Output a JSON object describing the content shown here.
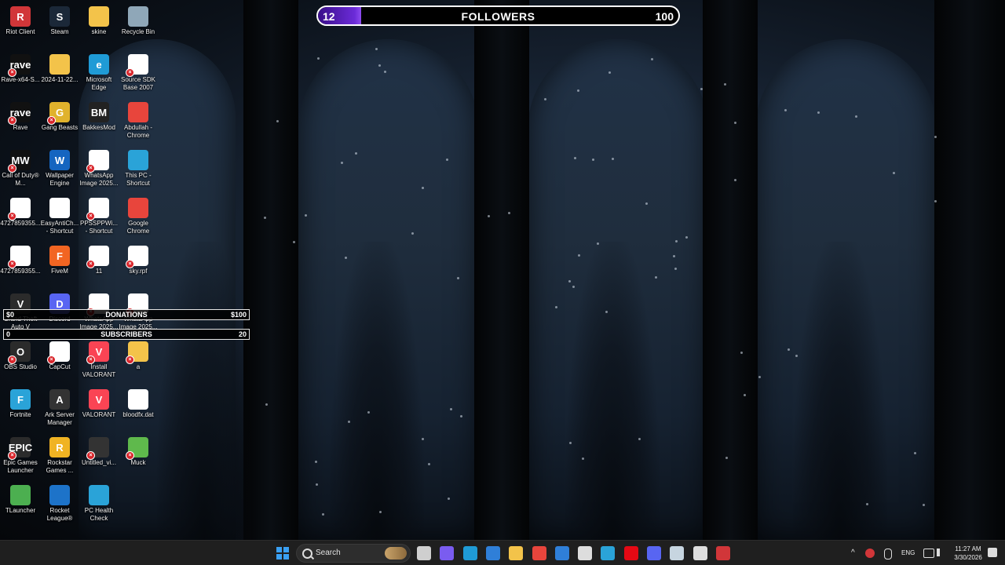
{
  "desktop": {
    "icons": [
      {
        "label": "Riot Client",
        "icon": "riot-client-icon",
        "color": "#d13639",
        "glyph": "R",
        "broken": false
      },
      {
        "label": "Steam",
        "icon": "steam-icon",
        "color": "#1b2838",
        "glyph": "S",
        "broken": false
      },
      {
        "label": "skine",
        "icon": "folder-icon",
        "color": "#f3c34a",
        "glyph": "",
        "broken": false
      },
      {
        "label": "Recycle Bin",
        "icon": "recycle-bin-icon",
        "color": "#8fa7b8",
        "glyph": "",
        "broken": false
      },
      {
        "label": "Rave-x64-S...",
        "icon": "rave-icon",
        "color": "#111111",
        "glyph": "rave",
        "broken": true
      },
      {
        "label": "2024-11-22...",
        "icon": "folder-icon",
        "color": "#f3c34a",
        "glyph": "",
        "broken": false
      },
      {
        "label": "Microsoft Edge",
        "icon": "edge-icon",
        "color": "#1f9bd6",
        "glyph": "e",
        "broken": false
      },
      {
        "label": "Source SDK Base 2007",
        "icon": "file-icon",
        "color": "#ffffff",
        "glyph": "",
        "broken": true
      },
      {
        "label": "Rave",
        "icon": "rave-icon",
        "color": "#111111",
        "glyph": "rave",
        "broken": true
      },
      {
        "label": "Gang Beasts",
        "icon": "gang-beasts-icon",
        "color": "#e0b22c",
        "glyph": "G",
        "broken": true
      },
      {
        "label": "BakkesMod",
        "icon": "bakkesmod-icon",
        "color": "#222222",
        "glyph": "BM",
        "broken": false
      },
      {
        "label": "Abdullah - Chrome",
        "icon": "chrome-icon",
        "color": "#e8453c",
        "glyph": "",
        "broken": false
      },
      {
        "label": "Call of Duty® M...",
        "icon": "call-of-duty-icon",
        "color": "#111111",
        "glyph": "MW",
        "broken": true
      },
      {
        "label": "Wallpaper Engine",
        "icon": "wallpaper-engine-icon",
        "color": "#1565c0",
        "glyph": "W",
        "broken": false
      },
      {
        "label": "WhatsApp Image 2025...",
        "icon": "image-file-icon",
        "color": "#ffffff",
        "glyph": "",
        "broken": true
      },
      {
        "label": "This PC - Shortcut",
        "icon": "this-pc-icon",
        "color": "#2aa3d8",
        "glyph": "",
        "broken": false
      },
      {
        "label": "4727859355...",
        "icon": "video-file-icon",
        "color": "#ffffff",
        "glyph": "",
        "broken": true
      },
      {
        "label": "EasyAntiCh... - Shortcut",
        "icon": "easyanticheat-icon",
        "color": "#ffffff",
        "glyph": "",
        "broken": false
      },
      {
        "label": "PPSSPPWi... - Shortcut",
        "icon": "ppsspp-icon",
        "color": "#ffffff",
        "glyph": "",
        "broken": true
      },
      {
        "label": "Google Chrome",
        "icon": "chrome-icon",
        "color": "#e8453c",
        "glyph": "",
        "broken": false
      },
      {
        "label": "4727859355...",
        "icon": "video-file-icon",
        "color": "#ffffff",
        "glyph": "",
        "broken": true
      },
      {
        "label": "FiveM",
        "icon": "fivem-icon",
        "color": "#f26522",
        "glyph": "F",
        "broken": false
      },
      {
        "label": "11",
        "icon": "image-file-icon",
        "color": "#ffffff",
        "glyph": "",
        "broken": true
      },
      {
        "label": "sky.rpf",
        "icon": "file-icon",
        "color": "#ffffff",
        "glyph": "",
        "broken": true
      },
      {
        "label": "Grand Theft Auto V",
        "icon": "gta-v-icon",
        "color": "#2b2b2b",
        "glyph": "V",
        "broken": false
      },
      {
        "label": "Discord",
        "icon": "discord-icon",
        "color": "#5865f2",
        "glyph": "D",
        "broken": false
      },
      {
        "label": "WhatsApp Image 2025...",
        "icon": "image-file-icon",
        "color": "#ffffff",
        "glyph": "",
        "broken": true
      },
      {
        "label": "WhatsApp Image 2025...",
        "icon": "image-file-icon",
        "color": "#ffffff",
        "glyph": "",
        "broken": true
      },
      {
        "label": "OBS Studio",
        "icon": "obs-studio-icon",
        "color": "#2b2b2b",
        "glyph": "O",
        "broken": true
      },
      {
        "label": "CapCut",
        "icon": "capcut-icon",
        "color": "#ffffff",
        "glyph": "",
        "broken": true
      },
      {
        "label": "Install VALORANT",
        "icon": "valorant-icon",
        "color": "#fa4454",
        "glyph": "V",
        "broken": true
      },
      {
        "label": "a",
        "icon": "folder-icon",
        "color": "#f3c34a",
        "glyph": "",
        "broken": true
      },
      {
        "label": "Fortnite",
        "icon": "fortnite-icon",
        "color": "#2aa3d8",
        "glyph": "F",
        "broken": false
      },
      {
        "label": "Ark Server Manager",
        "icon": "ark-server-manager-icon",
        "color": "#333333",
        "glyph": "A",
        "broken": false
      },
      {
        "label": "VALORANT",
        "icon": "valorant-icon",
        "color": "#fa4454",
        "glyph": "V",
        "broken": false
      },
      {
        "label": "bloodfx.dat",
        "icon": "file-icon",
        "color": "#ffffff",
        "glyph": "",
        "broken": false
      },
      {
        "label": "Epic Games Launcher",
        "icon": "epic-games-icon",
        "color": "#2b2b2b",
        "glyph": "EPIC",
        "broken": true
      },
      {
        "label": "Rockstar Games ...",
        "icon": "rockstar-icon",
        "color": "#f0b323",
        "glyph": "R",
        "broken": false
      },
      {
        "label": "Untitled_vi...",
        "icon": "video-file-icon",
        "color": "#333333",
        "glyph": "",
        "broken": true
      },
      {
        "label": "Muck",
        "icon": "muck-icon",
        "color": "#5fb94c",
        "glyph": "",
        "broken": true
      },
      {
        "label": "TLauncher",
        "icon": "tlauncher-icon",
        "color": "#4caf50",
        "glyph": "",
        "broken": false
      },
      {
        "label": "Rocket League®",
        "icon": "rocket-league-icon",
        "color": "#1d73c9",
        "glyph": "",
        "broken": false
      },
      {
        "label": "PC Health Check",
        "icon": "pc-health-check-icon",
        "color": "#2aa3d8",
        "glyph": "",
        "broken": false
      }
    ]
  },
  "overlay": {
    "followers": {
      "current": "12",
      "label": "FOLLOWERS",
      "goal": "100",
      "progress_fraction": 0.12,
      "fill_color": "#6b2bd8"
    },
    "donations": {
      "current": "$0",
      "label": "DONATIONS",
      "goal": "$100"
    },
    "subscribers": {
      "current": "0",
      "label": "SUBSCRIBERS",
      "goal": "20"
    }
  },
  "taskbar": {
    "search_placeholder": "Search",
    "pinned": [
      {
        "icon": "task-view-icon",
        "color": "#cfcfcf"
      },
      {
        "icon": "copilot-icon",
        "color": "#7a5cf0"
      },
      {
        "icon": "edge-icon",
        "color": "#1f9bd6"
      },
      {
        "icon": "microsoft-store-icon",
        "color": "#2f7fd8"
      },
      {
        "icon": "file-explorer-icon",
        "color": "#f3c34a"
      },
      {
        "icon": "chrome-icon",
        "color": "#e8453c"
      },
      {
        "icon": "mail-icon",
        "color": "#2f7fd8"
      },
      {
        "icon": "capture-icon",
        "color": "#dddddd"
      },
      {
        "icon": "edge-dev-icon",
        "color": "#2aa3d8"
      },
      {
        "icon": "netflix-icon",
        "color": "#e50914"
      },
      {
        "icon": "discord-icon",
        "color": "#5865f2"
      },
      {
        "icon": "steam-icon",
        "color": "#c7d5e0"
      },
      {
        "icon": "obs-icon",
        "color": "#dddddd"
      },
      {
        "icon": "riot-client-icon",
        "color": "#d13639"
      }
    ],
    "tray": {
      "language": "ENG",
      "time": "11:27 AM",
      "date": "3/30/2026"
    }
  }
}
